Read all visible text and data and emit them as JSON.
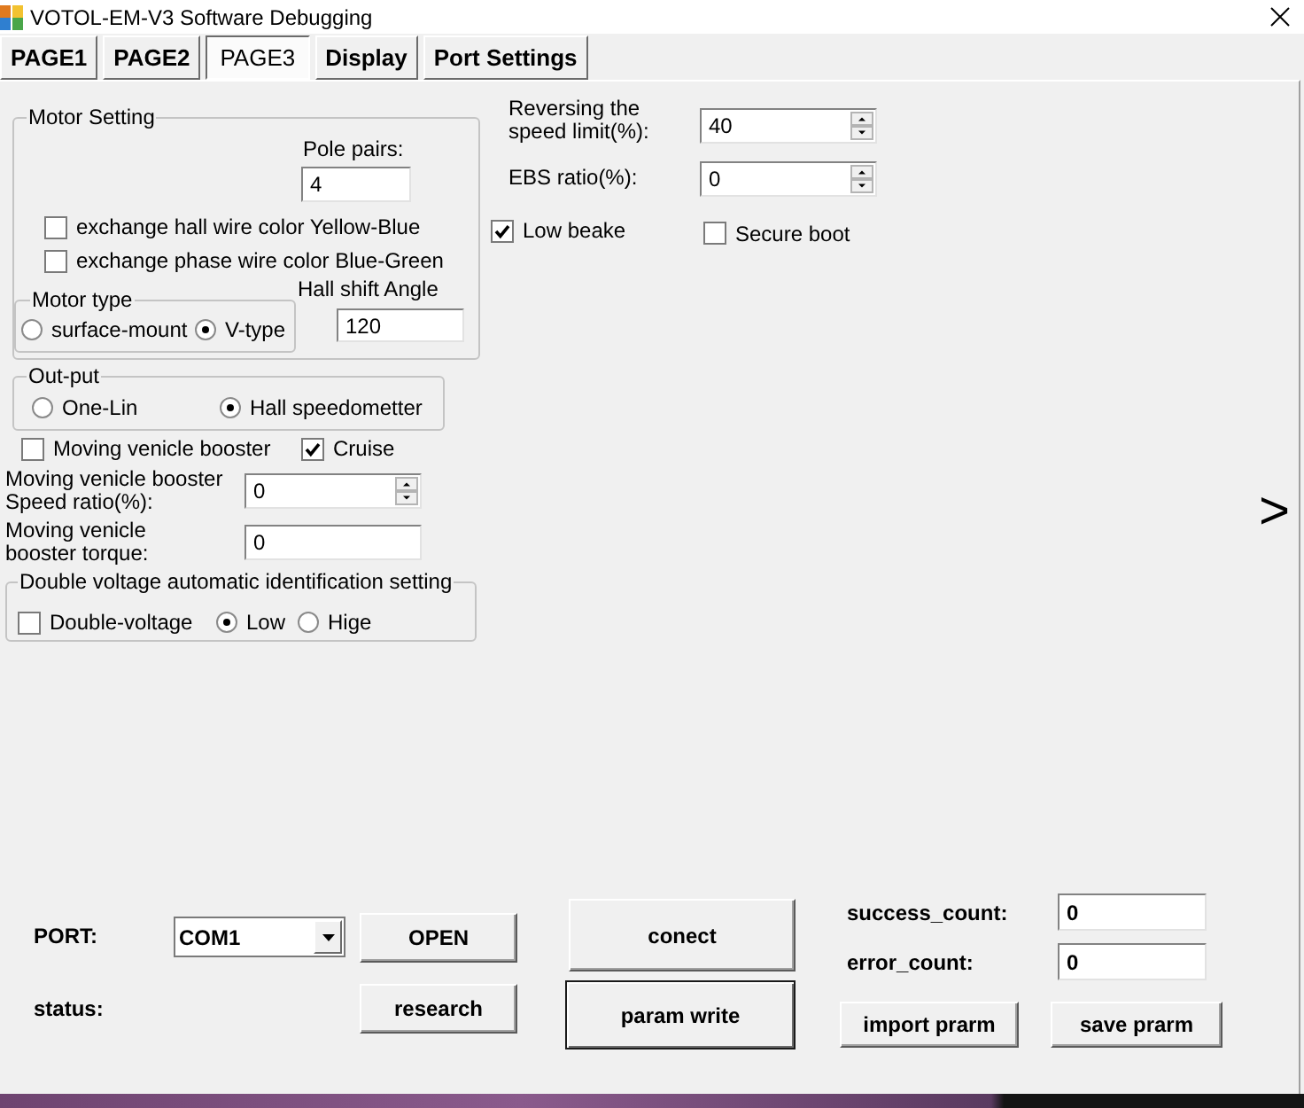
{
  "window": {
    "title": "VOTOL-EM-V3 Software Debugging"
  },
  "tabs": [
    {
      "label": "PAGE1",
      "selected": false
    },
    {
      "label": "PAGE2",
      "selected": false
    },
    {
      "label": "PAGE3",
      "selected": true
    },
    {
      "label": "Display",
      "selected": false
    },
    {
      "label": "Port Settings",
      "selected": false
    }
  ],
  "motor_setting": {
    "title": "Motor Setting",
    "pole_pairs": {
      "label": "Pole pairs:",
      "value": "4"
    },
    "checkboxes": [
      {
        "label": "exchange hall wire color Yellow-Blue",
        "checked": false
      },
      {
        "label": "exchange phase wire color Blue-Green",
        "checked": false
      }
    ],
    "motor_type": {
      "title": "Motor type",
      "options": [
        {
          "label": "surface-mount",
          "selected": false
        },
        {
          "label": "V-type",
          "selected": true
        }
      ]
    },
    "hall_shift_angle": {
      "label": "Hall shift Angle",
      "value": "120"
    }
  },
  "output": {
    "title": "Out-put",
    "options": [
      {
        "label": "One-Lin",
        "selected": false
      },
      {
        "label": "Hall speedometter",
        "selected": true
      }
    ]
  },
  "booster_checkboxes": [
    {
      "label": "Moving venicle booster",
      "checked": false
    },
    {
      "label": "Cruise",
      "checked": true
    }
  ],
  "booster_fields": [
    {
      "label_lines": [
        "Moving venicle booster",
        "Speed ratio(%):"
      ],
      "value": "0",
      "kind": "spin"
    },
    {
      "label_lines": [
        "Moving venicle",
        "booster torque:"
      ],
      "value": "0",
      "kind": "text"
    }
  ],
  "double_voltage": {
    "title": "Double voltage automatic identification setting",
    "items": [
      {
        "kind": "checkbox",
        "label": "Double-voltage",
        "checked": false
      },
      {
        "kind": "radio",
        "label": "Low",
        "selected": true
      },
      {
        "kind": "radio",
        "label": "Hige",
        "selected": false
      }
    ]
  },
  "speed_fields": [
    {
      "label_lines": [
        "Reversing the",
        "speed limit(%):"
      ],
      "value": "40"
    },
    {
      "label_lines": [
        "EBS ratio(%):"
      ],
      "value": "0"
    }
  ],
  "option_checkboxes": [
    {
      "label": "Low beake",
      "checked": true
    },
    {
      "label": "Secure boot",
      "checked": false
    }
  ],
  "next_button": {
    "label": ">"
  },
  "connection": {
    "port_label": "PORT:",
    "port": "COM1",
    "status_label": "status:",
    "open_button": "OPEN",
    "research_button": "research",
    "connect_button": "conect",
    "param_write_button": "param write"
  },
  "counters": [
    {
      "label": "success_count:",
      "value": "0"
    },
    {
      "label": "error_count:",
      "value": "0"
    }
  ],
  "file_buttons": {
    "import_button": "import prarm",
    "save_button": "save prarm"
  }
}
